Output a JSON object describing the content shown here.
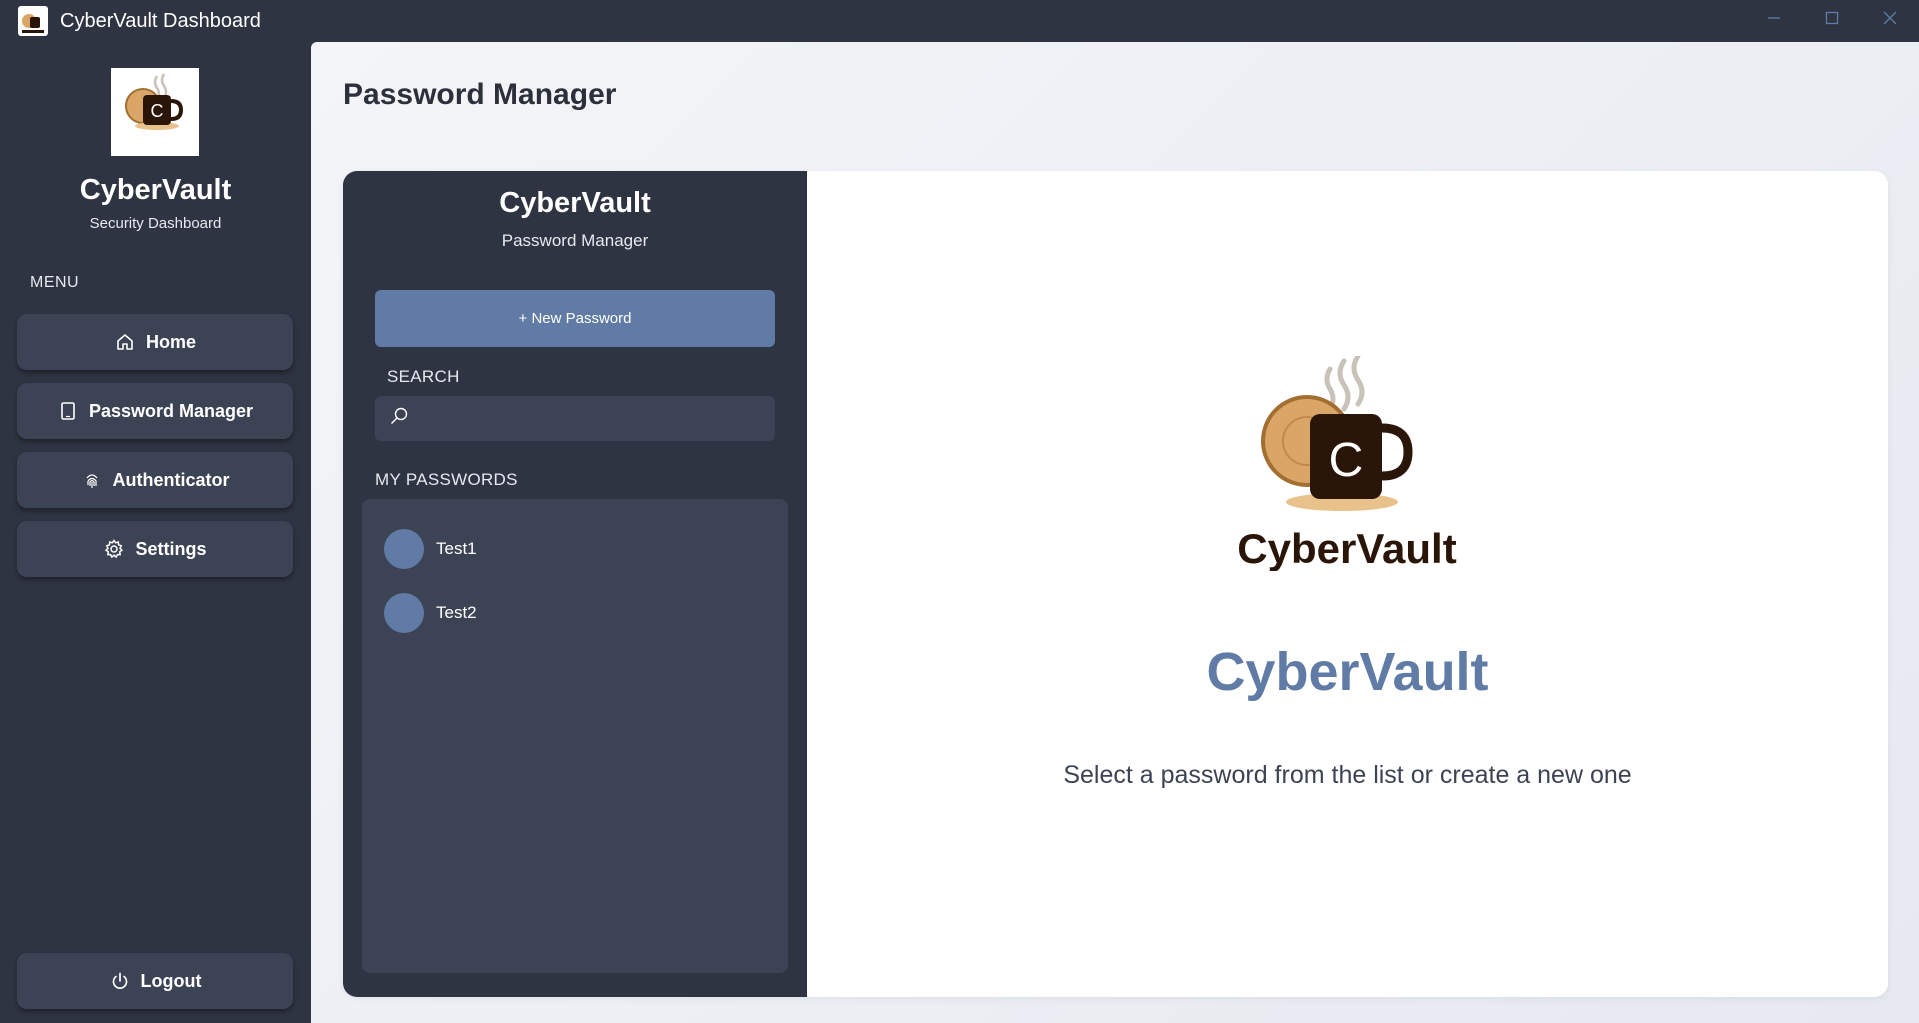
{
  "window": {
    "title": "CyberVault Dashboard",
    "controls": {
      "minimize": "—",
      "maximize": "☐",
      "close": "✕"
    }
  },
  "sidebar": {
    "logo_text": "CyberVault",
    "brand": "CyberVault",
    "subtitle": "Security Dashboard",
    "menu_label": "MENU",
    "items": [
      {
        "label": "Home",
        "icon": "home-icon"
      },
      {
        "label": "Password Manager",
        "icon": "tablet-icon"
      },
      {
        "label": "Authenticator",
        "icon": "fingerprint-icon"
      },
      {
        "label": "Settings",
        "icon": "gear-icon"
      }
    ],
    "logout": {
      "label": "Logout",
      "icon": "power-icon"
    }
  },
  "main": {
    "page_title": "Password Manager",
    "panel": {
      "title": "CyberVault",
      "subtitle": "Password Manager",
      "new_button": "+ New Password",
      "search_label": "SEARCH",
      "search_value": "",
      "list_label": "MY PASSWORDS",
      "passwords": [
        {
          "name": "Test1"
        },
        {
          "name": "Test2"
        }
      ]
    },
    "detail": {
      "logo_text": "CyberVault",
      "brand": "CyberVault",
      "hint": "Select a password from the list or create a new one"
    }
  },
  "colors": {
    "sidebar_bg": "#2e3441",
    "button_bg": "#3c4354",
    "accent": "#5f7ba6",
    "mug": "#2a1608",
    "donut": "#d9a668",
    "steam": "#c8c2b8"
  }
}
